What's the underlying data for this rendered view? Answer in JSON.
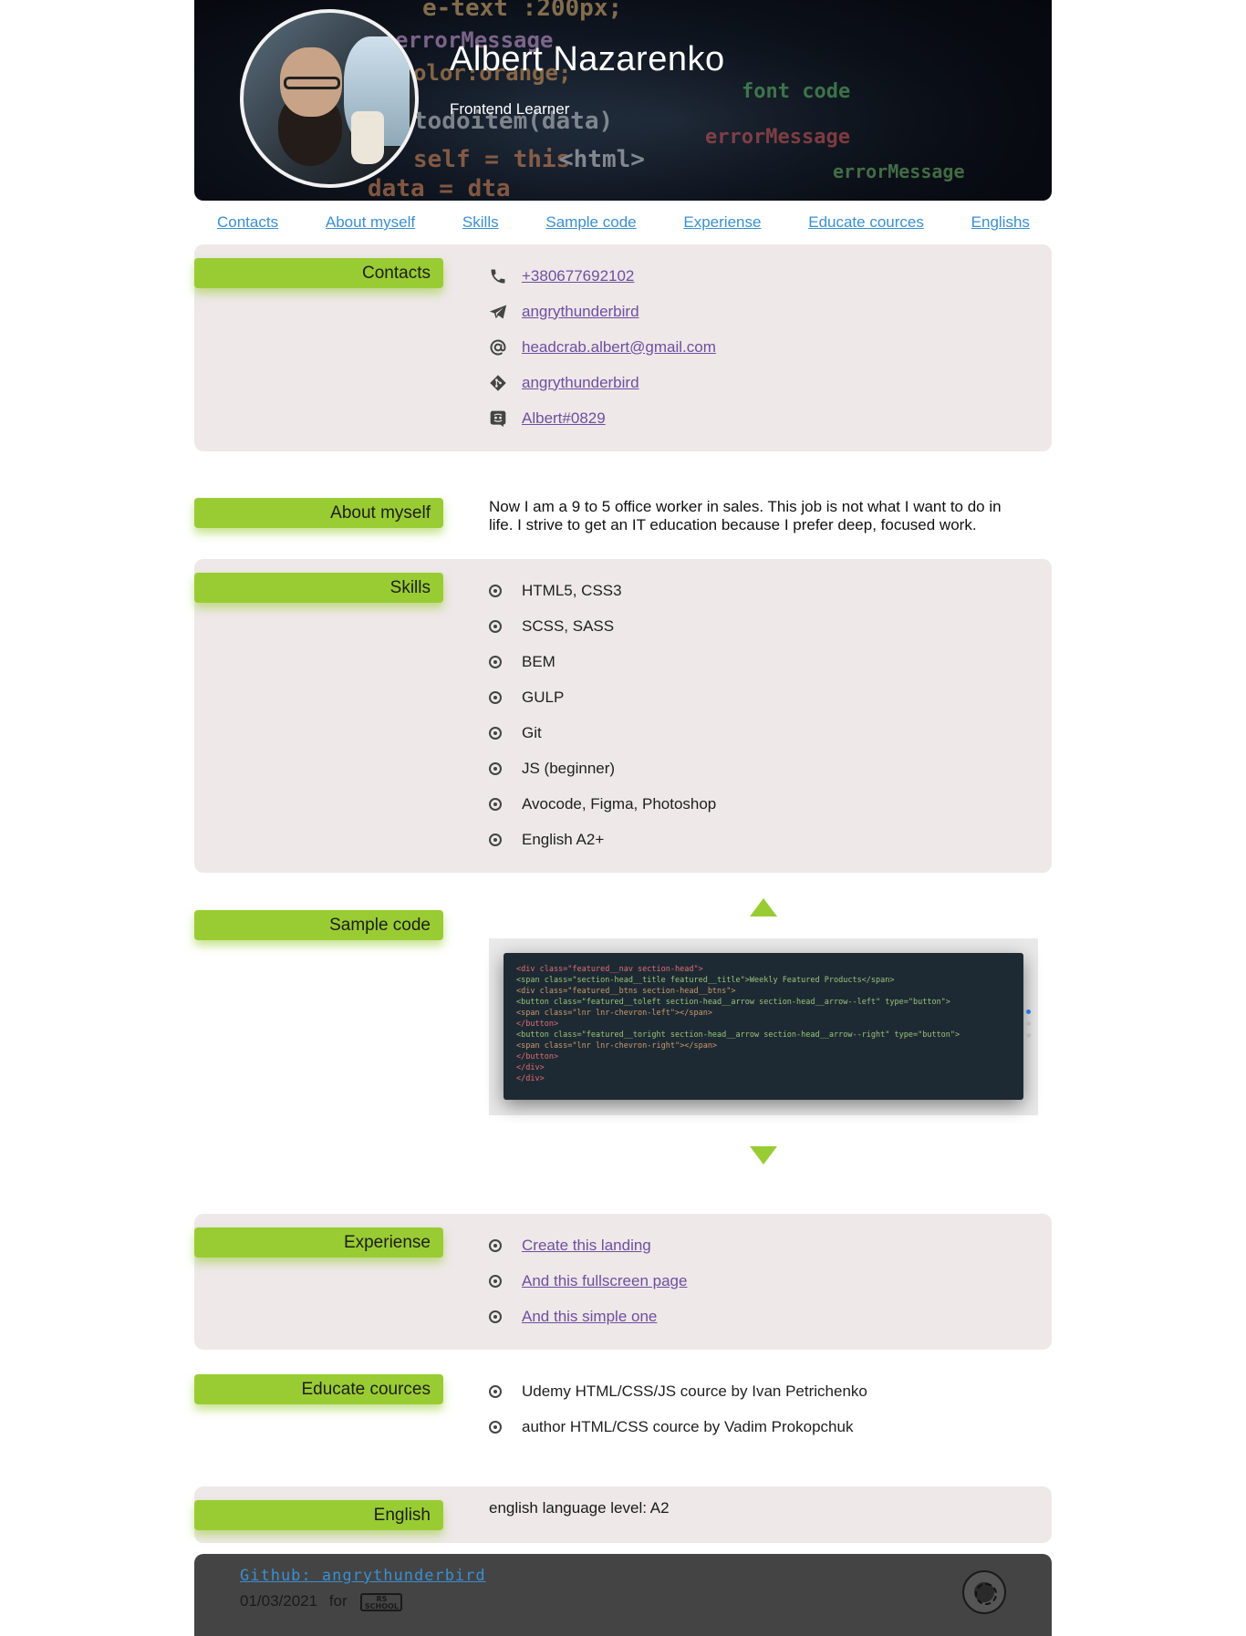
{
  "header": {
    "name": "Albert Nazarenko",
    "role": "Frontend Learner"
  },
  "nav": {
    "items": [
      "Contacts",
      "About myself",
      "Skills",
      "Sample code",
      "Experiense",
      "Educate cources",
      "Englishs"
    ]
  },
  "contacts": {
    "label": "Contacts",
    "items": [
      {
        "icon": "phone-icon",
        "text": "+380677692102"
      },
      {
        "icon": "telegram-icon",
        "text": "angrythunderbird"
      },
      {
        "icon": "at-icon",
        "text": "headcrab.albert@gmail.com"
      },
      {
        "icon": "git-icon",
        "text": "angrythunderbird"
      },
      {
        "icon": "discord-icon",
        "text": "Albert#0829"
      }
    ]
  },
  "about": {
    "label": "About myself",
    "text": "Now I am a 9 to 5 office worker in sales. This job is not what I want to do in life. I strive to get an IT education because I prefer deep, focused work."
  },
  "skills": {
    "label": "Skills",
    "items": [
      "HTML5, CSS3",
      "SCSS, SASS",
      "BEM",
      "GULP",
      "Git",
      "JS (beginner)",
      "Avocode, Figma, Photoshop",
      "English A2+"
    ]
  },
  "sample": {
    "label": "Sample code",
    "code_lines": [
      "<div class=\"featured__nav section-head\">",
      "  <span class=\"section-head__title featured__title\">Weekly Featured Products</span>",
      "  <div class=\"featured__btns section-head__btns\">",
      "    <button class=\"featured__toleft section-head__arrow section-head__arrow--left\" type=\"button\">",
      "      <span class=\"lnr lnr-chevron-left\"></span>",
      "    </button>",
      "    <button class=\"featured__toright section-head__arrow section-head__arrow--right\" type=\"button\">",
      "      <span class=\"lnr lnr-chevron-right\"></span>",
      "    </button>",
      "  </div>",
      "</div>"
    ]
  },
  "experience": {
    "label": "Experiense",
    "items": [
      "Create this landing",
      "And this fullscreen page",
      "And this simple one"
    ]
  },
  "education": {
    "label": "Educate cources",
    "items": [
      "Udemy HTML/CSS/JS cource by Ivan Petrichenko",
      "author HTML/CSS cource by Vadim Prokopchuk"
    ]
  },
  "english": {
    "label": "English",
    "text": "english language level: A2"
  },
  "footer": {
    "github": "Github: angrythunderbird",
    "date": "01/03/2021",
    "for": "for",
    "rs_logo_top": "RS",
    "rs_logo_bottom": "SCHOOL"
  },
  "colors": {
    "accent": "#99cc33",
    "shaded_bg": "#eee8e8",
    "link": "#3a8fd0",
    "visited_link": "#6f4fa0",
    "footer_bg": "#444444"
  }
}
